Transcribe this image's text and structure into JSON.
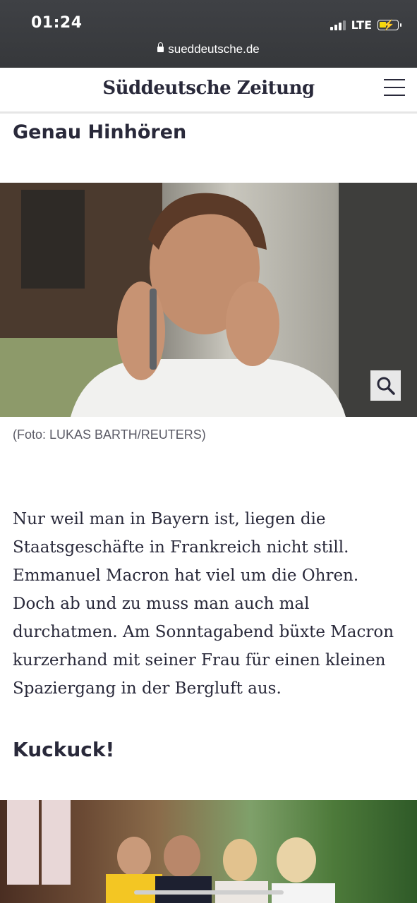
{
  "status_bar": {
    "time": "01:24",
    "network": "LTE"
  },
  "browser": {
    "url": "sueddeutsche.de"
  },
  "site": {
    "logo": "Süddeutsche Zeitung"
  },
  "article": {
    "section_title": "Genau Hinhören",
    "caption": "(Foto: LUKAS BARTH/REUTERS)",
    "paragraph": "Nur weil man in Bayern ist, liegen die Staatsgeschäfte in Frankreich nicht still. Emmanuel Macron hat viel um die Ohren. Doch ab und zu muss man auch mal durchatmen. Am Sonntagabend büxte Macron kurzerhand mit seiner Frau für einen kleinen Spaziergang in der Bergluft aus.",
    "subheading": "Kuckuck!"
  }
}
